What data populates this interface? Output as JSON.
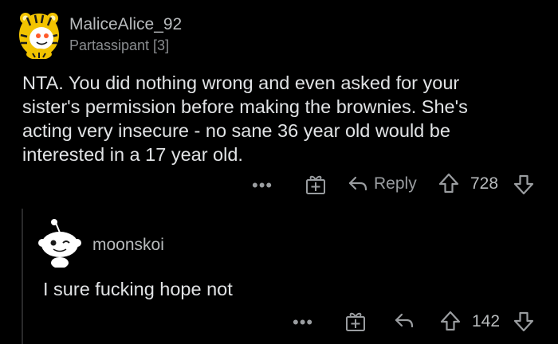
{
  "comment": {
    "username": "MaliceAlice_92",
    "flair": "Partassipant [3]",
    "body_lines": [
      "NTA. You did nothing wrong and even asked for your",
      "sister's permission before making the brownies. She's",
      "acting very insecure - no sane 36 year old would be",
      "interested in a 17 year old."
    ],
    "more_label": "•••",
    "reply_label": "Reply",
    "vote_count": "728",
    "avatar_icon": "tiger-costume-avatar-icon"
  },
  "reply": {
    "username": "moonskoi",
    "body": "I sure fucking hope not",
    "more_label": "•••",
    "vote_count": "142",
    "avatar_icon": "snoo-avatar-icon"
  },
  "colors": {
    "background": "#000000",
    "text": "#e1e3e5",
    "muted": "#9a9da0",
    "avatar_yellow": "#f2c300"
  }
}
